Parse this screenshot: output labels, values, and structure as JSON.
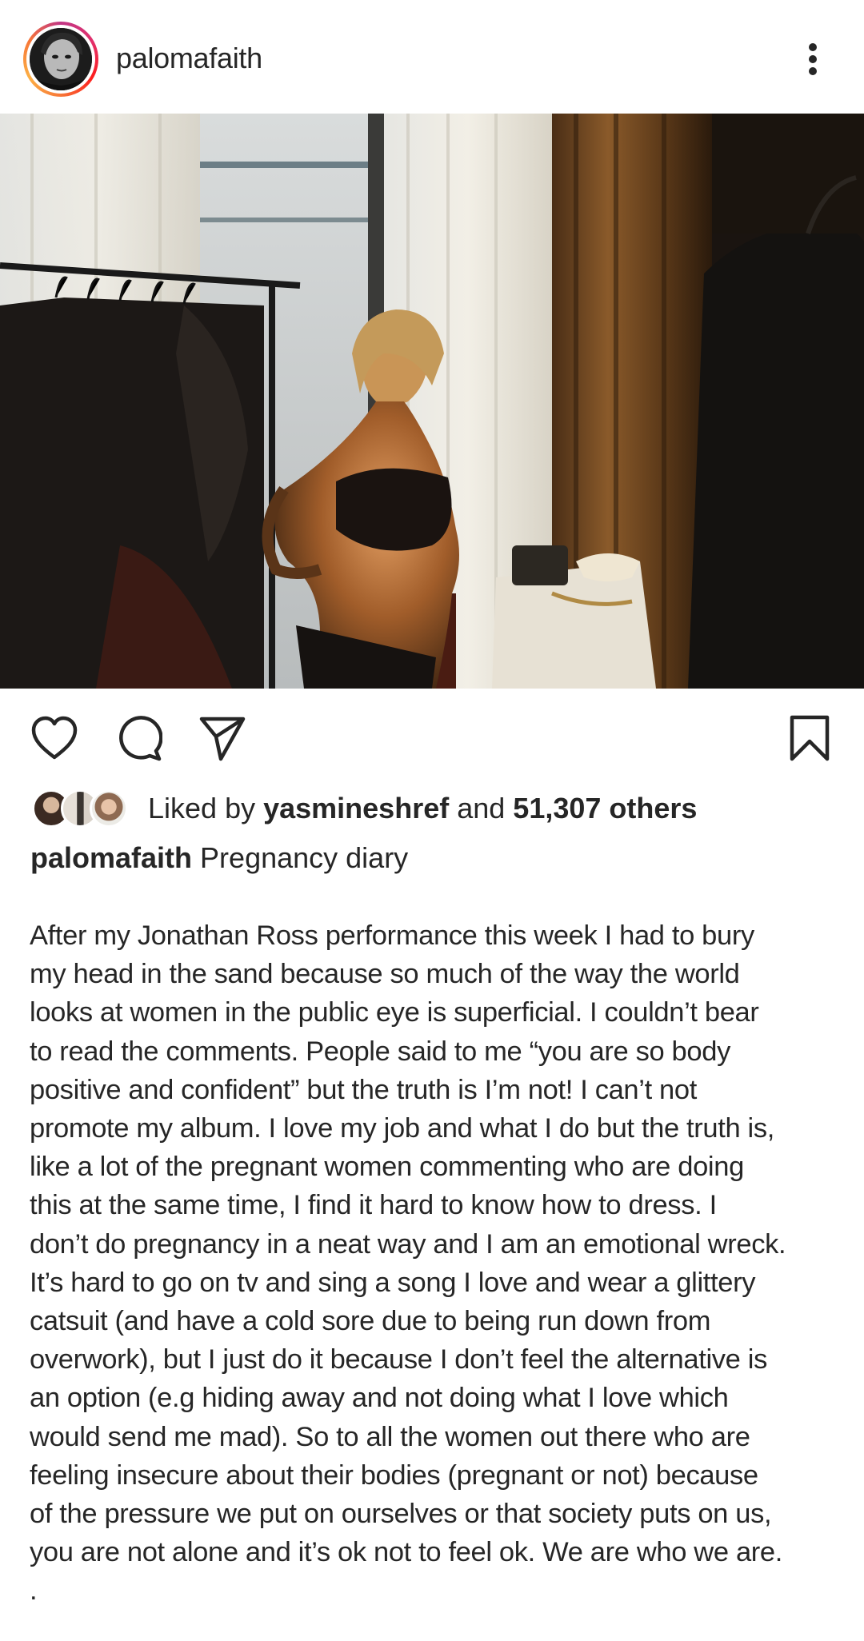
{
  "post": {
    "username": "palomafaith",
    "menu_icon": "more-vertical-icon",
    "avatar_icon": "profile-avatar",
    "photo_description": ""
  },
  "actions": {
    "like_icon": "heart-icon",
    "comment_icon": "comment-icon",
    "share_icon": "send-icon",
    "save_icon": "bookmark-icon"
  },
  "likes": {
    "prefix": "Liked by ",
    "user": "yasmineshref",
    "connector": " and ",
    "others": "51,307 others"
  },
  "caption": {
    "username": "palomafaith",
    "title": "Pregnancy diary",
    "lines": [
      "After my Jonathan Ross performance this week I had to bury",
      "my head in the sand because so much of the way the world",
      "looks at women in the public eye is superficial. I couldn’t bear",
      "to read the comments. People said to me “you are so body",
      "positive and confident” but the truth is I’m not! I can’t not",
      "promote my album. I love my job and what I do but the truth is,",
      "like a lot of the pregnant women commenting who are doing",
      "this at the same time, I find it hard to know how to dress. I",
      "don’t do pregnancy in a neat way and I am an emotional wreck.",
      "It’s hard to go on tv and sing a song I love and wear a glittery",
      "catsuit (and have a cold sore due to being run down from",
      "overwork), but I just do it because I don’t feel the alternative is",
      "an option (e.g hiding away and not doing what I love which",
      "would send me mad). So to all the women out there who are",
      "feeling insecure about their bodies (pregnant or not) because",
      "of the pressure we put on ourselves or that society puts on us,",
      "you are not alone and it’s ok not to feel ok. We are who we are.",
      "."
    ]
  },
  "colors": {
    "text": "#262626",
    "background": "#ffffff",
    "story_ring_start": "#c13584",
    "story_ring_end": "#fcaf45"
  }
}
